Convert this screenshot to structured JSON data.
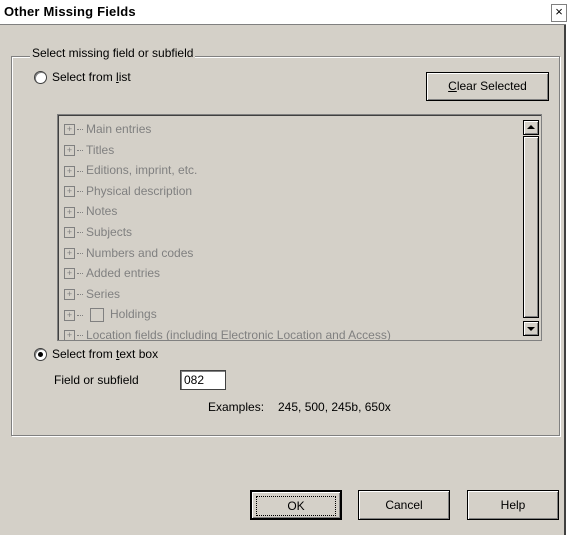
{
  "window": {
    "title": "Other Missing Fields",
    "close_glyph": "×"
  },
  "group": {
    "label": "Select missing field or subfield"
  },
  "option_list": {
    "label_prefix": "Select from ",
    "label_accel": "l",
    "label_suffix": "ist",
    "selected": false
  },
  "clear_button": {
    "label_accel": "C",
    "label_rest": "lear Selected"
  },
  "tree": {
    "items": [
      {
        "label": "Main entries"
      },
      {
        "label": "Titles"
      },
      {
        "label": "Editions, imprint, etc."
      },
      {
        "label": "Physical description"
      },
      {
        "label": "Notes"
      },
      {
        "label": "Subjects"
      },
      {
        "label": "Numbers and codes"
      },
      {
        "label": "Added entries"
      },
      {
        "label": "Series"
      },
      {
        "label": "Holdings"
      },
      {
        "label": "Location fields (including Electronic Location and Access)"
      }
    ]
  },
  "option_text": {
    "label_prefix": "Select from ",
    "label_accel": "t",
    "label_suffix": "ext box",
    "selected": true
  },
  "field": {
    "label": "Field or subfield",
    "value": "082"
  },
  "examples": {
    "label": "Examples:",
    "value": "245, 500, 245b, 650x"
  },
  "buttons": {
    "ok": "OK",
    "cancel": "Cancel",
    "help": "Help"
  }
}
